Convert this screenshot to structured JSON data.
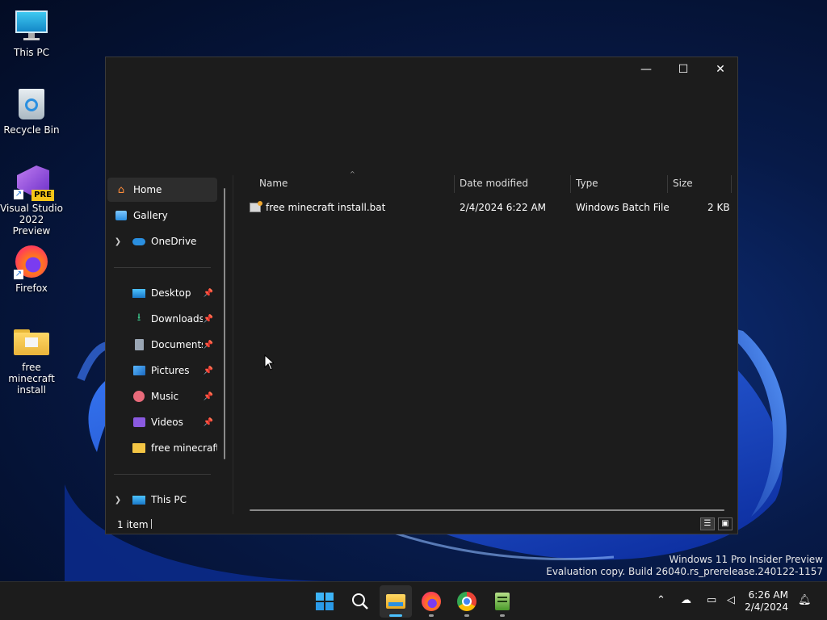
{
  "desktop": {
    "icons": [
      {
        "label": "This PC",
        "icon": "monitor-icon"
      },
      {
        "label": "Recycle Bin",
        "icon": "recycle-bin-icon"
      },
      {
        "label": "Visual Studio 2022 Preview",
        "badge": "PRE",
        "icon": "visual-studio-icon"
      },
      {
        "label": "Firefox",
        "icon": "firefox-icon"
      },
      {
        "label": "free minecraft install",
        "icon": "folder-icon"
      }
    ]
  },
  "window": {
    "controls": {
      "minimize": "—",
      "maximize": "☐",
      "close": "✕"
    },
    "nav": {
      "items": [
        {
          "label": "Home",
          "icon": "home-icon",
          "selected": true
        },
        {
          "label": "Gallery",
          "icon": "gallery-icon"
        },
        {
          "label": "OneDrive",
          "icon": "cloud-icon",
          "expandable": true
        },
        {
          "label": "Desktop",
          "icon": "desktop-icon",
          "pinned": true
        },
        {
          "label": "Downloads",
          "icon": "download-icon",
          "pinned": true
        },
        {
          "label": "Documents",
          "icon": "documents-icon",
          "pinned": true
        },
        {
          "label": "Pictures",
          "icon": "pictures-icon",
          "pinned": true
        },
        {
          "label": "Music",
          "icon": "music-icon",
          "pinned": true
        },
        {
          "label": "Videos",
          "icon": "videos-icon",
          "pinned": true
        },
        {
          "label": "free minecraft ir",
          "icon": "folder-icon"
        },
        {
          "label": "This PC",
          "icon": "this-pc-icon",
          "expandable": true
        }
      ]
    },
    "columns": {
      "name": "Name",
      "date": "Date modified",
      "type": "Type",
      "size": "Size"
    },
    "files": [
      {
        "name": "free minecraft install.bat",
        "date": "2/4/2024 6:22 AM",
        "type": "Windows Batch File",
        "size": "2 KB",
        "icon": "batch-file-icon"
      }
    ],
    "status": {
      "count": "1 item"
    }
  },
  "watermark": {
    "line1": "Windows 11 Pro Insider Preview",
    "line2": "Evaluation copy. Build 26040.rs_prerelease.240122-1157"
  },
  "taskbar": {
    "apps": [
      "start-icon",
      "search-icon",
      "file-explorer-icon",
      "firefox-icon",
      "chrome-icon",
      "notepad-icon"
    ],
    "clock": {
      "time": "6:26 AM",
      "date": "2/4/2024"
    }
  },
  "colors": {
    "accent": "#4cc2ff",
    "window_bg": "#1c1c1c",
    "taskbar_bg": "#1c1c1c"
  }
}
